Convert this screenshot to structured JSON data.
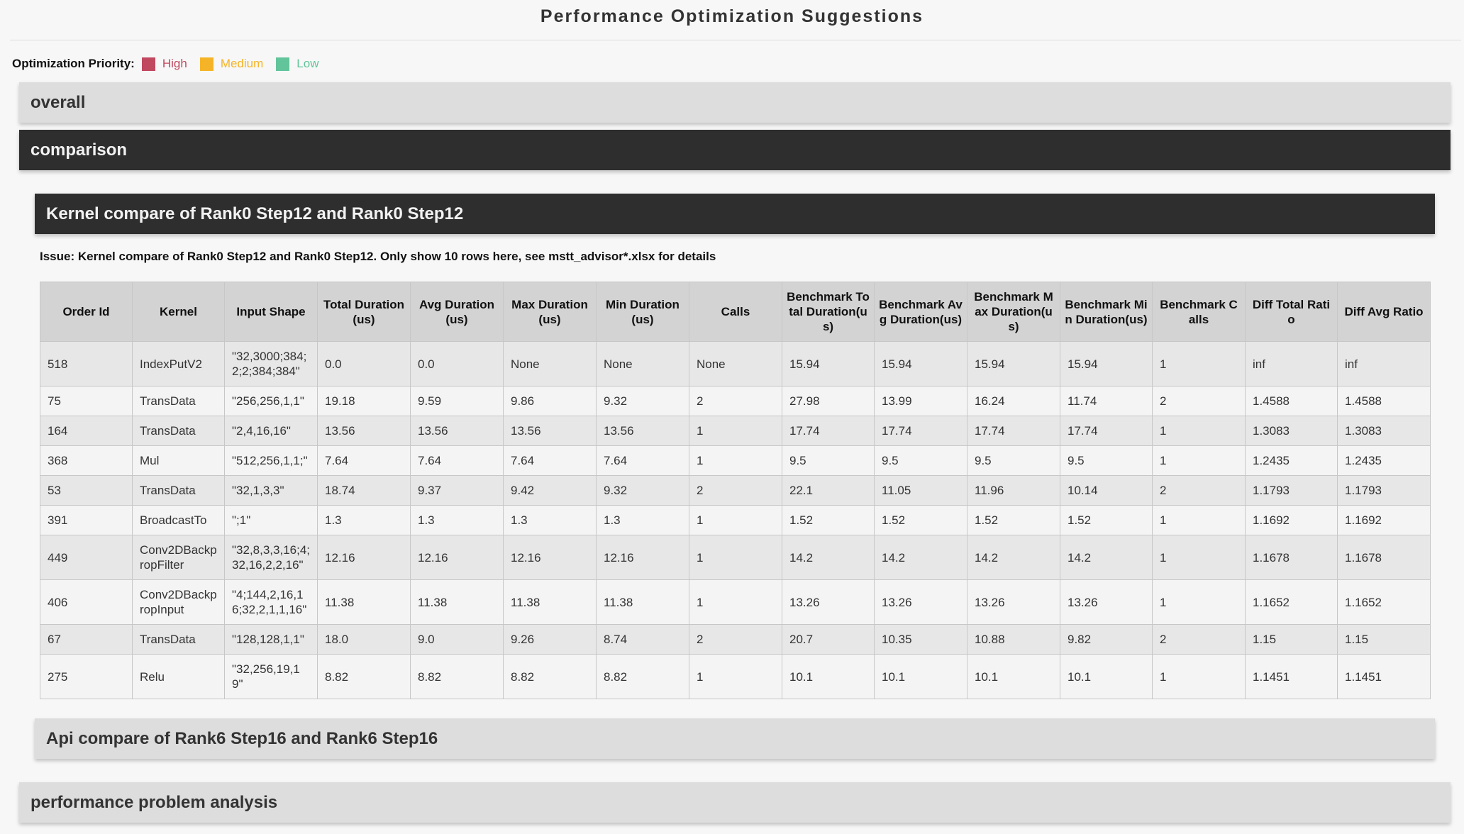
{
  "page_title": "Performance Optimization Suggestions",
  "legend": {
    "label": "Optimization Priority:",
    "items": [
      {
        "text": "High",
        "color": "#c0485f"
      },
      {
        "text": "Medium",
        "color": "#f5b428"
      },
      {
        "text": "Low",
        "color": "#62c49a"
      }
    ]
  },
  "sections": {
    "overall": "overall",
    "comparison": "comparison",
    "kernel_compare": "Kernel compare of Rank0 Step12 and Rank0 Step12",
    "api_compare": "Api compare of Rank6 Step16 and Rank6 Step16",
    "performance_problem": "performance problem analysis"
  },
  "issue": "Issue: Kernel compare of Rank0 Step12 and Rank0 Step12. Only show 10 rows here, see mstt_advisor*.xlsx for details",
  "table": {
    "headers": [
      "Order Id",
      "Kernel",
      "Input Shape",
      "Total Duration(us)",
      "Avg Duration(us)",
      "Max Duration(us)",
      "Min Duration(us)",
      "Calls",
      "Benchmark Total Duration(us)",
      "Benchmark Avg Duration(us)",
      "Benchmark Max Duration(us)",
      "Benchmark Min Duration(us)",
      "Benchmark Calls",
      "Diff Total Ratio",
      "Diff Avg Ratio"
    ],
    "rows": [
      [
        "518",
        "IndexPutV2",
        "\"32,3000;384;2;2;384;384\"",
        "0.0",
        "0.0",
        "None",
        "None",
        "None",
        "15.94",
        "15.94",
        "15.94",
        "15.94",
        "1",
        "inf",
        "inf"
      ],
      [
        "75",
        "TransData",
        "\"256,256,1,1\"",
        "19.18",
        "9.59",
        "9.86",
        "9.32",
        "2",
        "27.98",
        "13.99",
        "16.24",
        "11.74",
        "2",
        "1.4588",
        "1.4588"
      ],
      [
        "164",
        "TransData",
        "\"2,4,16,16\"",
        "13.56",
        "13.56",
        "13.56",
        "13.56",
        "1",
        "17.74",
        "17.74",
        "17.74",
        "17.74",
        "1",
        "1.3083",
        "1.3083"
      ],
      [
        "368",
        "Mul",
        "\"512,256,1,1;\"",
        "7.64",
        "7.64",
        "7.64",
        "7.64",
        "1",
        "9.5",
        "9.5",
        "9.5",
        "9.5",
        "1",
        "1.2435",
        "1.2435"
      ],
      [
        "53",
        "TransData",
        "\"32,1,3,3\"",
        "18.74",
        "9.37",
        "9.42",
        "9.32",
        "2",
        "22.1",
        "11.05",
        "11.96",
        "10.14",
        "2",
        "1.1793",
        "1.1793"
      ],
      [
        "391",
        "BroadcastTo",
        "\";1\"",
        "1.3",
        "1.3",
        "1.3",
        "1.3",
        "1",
        "1.52",
        "1.52",
        "1.52",
        "1.52",
        "1",
        "1.1692",
        "1.1692"
      ],
      [
        "449",
        "Conv2DBackpropFilter",
        "\"32,8,3,3,16;4;32,16,2,2,16\"",
        "12.16",
        "12.16",
        "12.16",
        "12.16",
        "1",
        "14.2",
        "14.2",
        "14.2",
        "14.2",
        "1",
        "1.1678",
        "1.1678"
      ],
      [
        "406",
        "Conv2DBackpropInput",
        "\"4;144,2,16,16;32,2,1,1,16\"",
        "11.38",
        "11.38",
        "11.38",
        "11.38",
        "1",
        "13.26",
        "13.26",
        "13.26",
        "13.26",
        "1",
        "1.1652",
        "1.1652"
      ],
      [
        "67",
        "TransData",
        "\"128,128,1,1\"",
        "18.0",
        "9.0",
        "9.26",
        "8.74",
        "2",
        "20.7",
        "10.35",
        "10.88",
        "9.82",
        "2",
        "1.15",
        "1.15"
      ],
      [
        "275",
        "Relu",
        "\"32,256,19,19\"",
        "8.82",
        "8.82",
        "8.82",
        "8.82",
        "1",
        "10.1",
        "10.1",
        "10.1",
        "10.1",
        "1",
        "1.1451",
        "1.1451"
      ]
    ]
  }
}
